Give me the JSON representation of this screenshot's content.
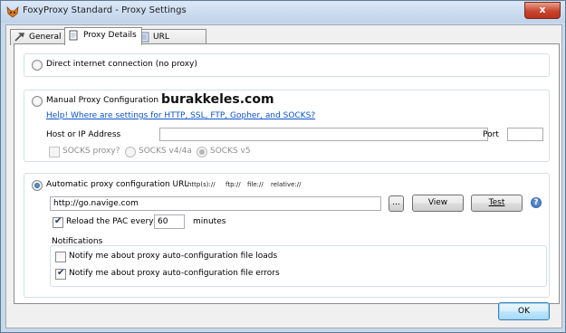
{
  "window": {
    "title": "FoxyProxy Standard - Proxy Settings",
    "close": "x"
  },
  "tabs": [
    {
      "label": "General",
      "icon": "wrench-icon"
    },
    {
      "label": "Proxy Details",
      "icon": "document-icon"
    },
    {
      "label": "URL Patterns",
      "icon": "list-icon"
    }
  ],
  "direct": {
    "label": "Direct internet connection (no proxy)"
  },
  "manual": {
    "label": "Manual Proxy Configuration",
    "help_link": "Help! Where are settings for HTTP, SSL, FTP, Gopher, and SOCKS?",
    "host_label": "Host or IP Address",
    "host_value": "",
    "port_label": "Port",
    "port_value": "",
    "socks_proxy_label": "SOCKS proxy?",
    "socks4_label": "SOCKS v4/4a",
    "socks5_label": "SOCKS v5"
  },
  "watermark": "burakkeles.com",
  "auto": {
    "label": "Automatic proxy configuration URL",
    "schemes": [
      "http(s)://",
      "ftp://",
      "file://",
      "relative://"
    ],
    "url": "http://go.navige.com",
    "browse_label": "...",
    "view_label": "View",
    "test_label": "Test",
    "reload_label": "Reload the PAC every",
    "reload_value": "60",
    "minutes_label": "minutes",
    "notifications_title": "Notifications",
    "notify_loads": "Notify me about proxy auto-configuration file loads",
    "notify_errors": "Notify me about proxy auto-configuration file errors"
  },
  "ok_label": "OK",
  "colors": {
    "link": "#0a52c9",
    "accent": "#1c5392",
    "close": "#c8452e"
  }
}
